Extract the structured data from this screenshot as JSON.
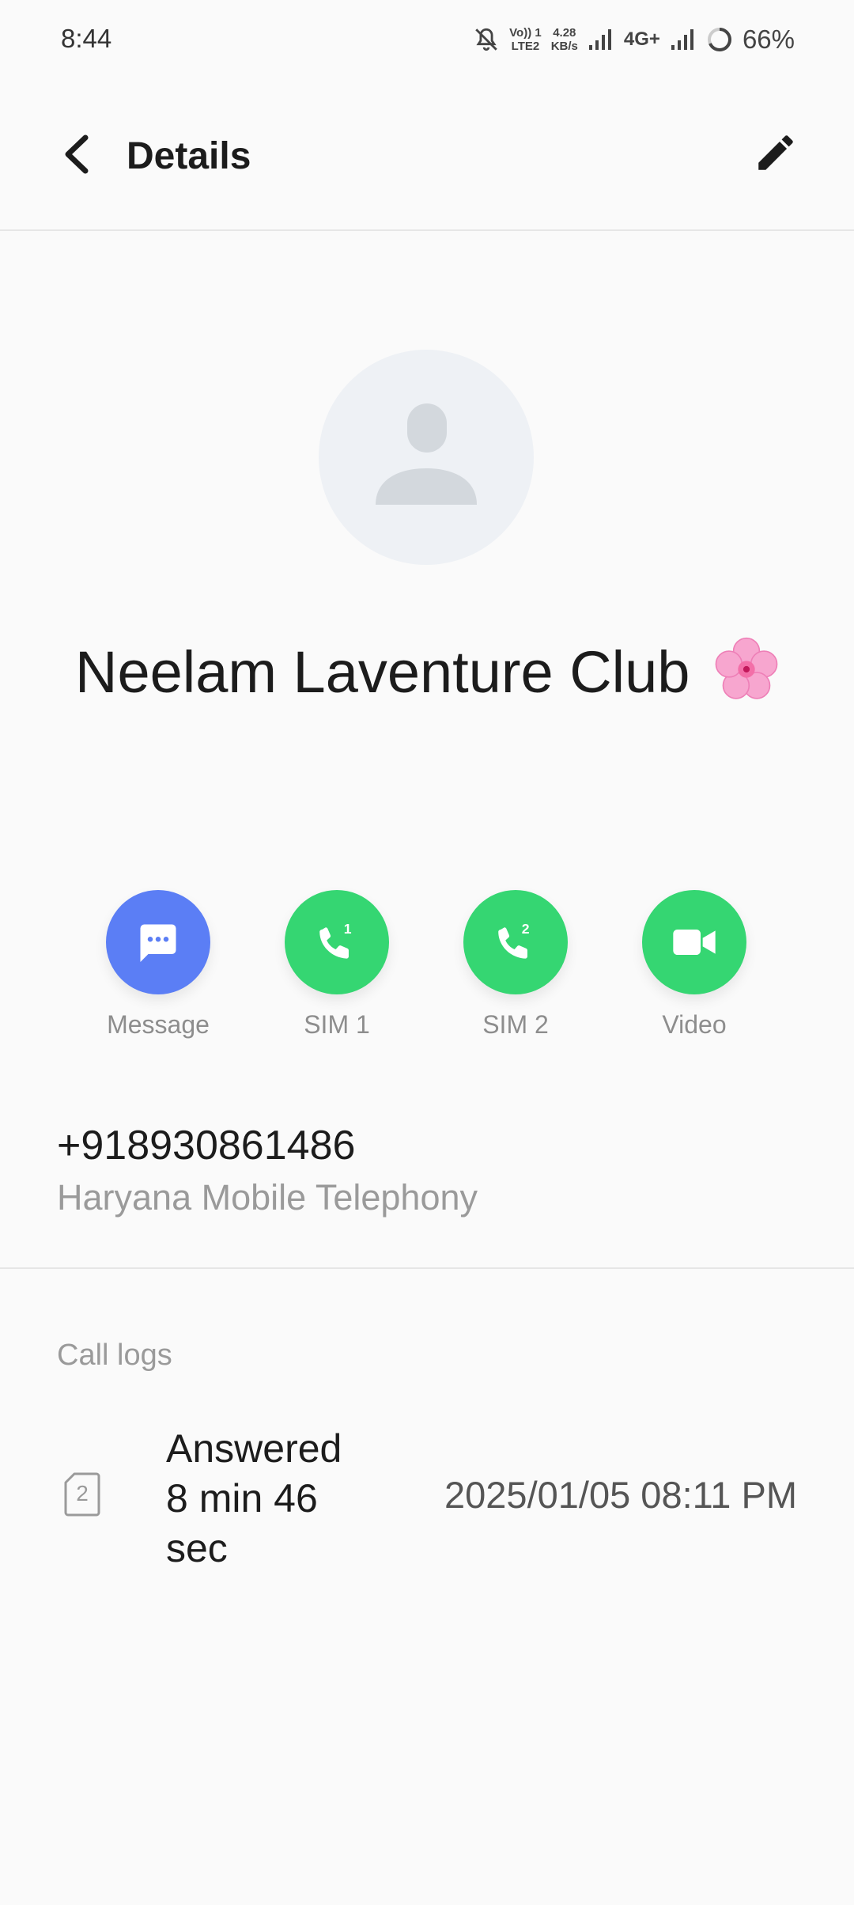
{
  "status_bar": {
    "time": "8:44",
    "net_line1": "Vo)) 1",
    "net_line2": "LTE2",
    "speed_value": "4.28",
    "speed_unit": "KB/s",
    "network_type": "4G+",
    "battery": "66%"
  },
  "app_bar": {
    "title": "Details"
  },
  "contact": {
    "name": "Neelam Laventure Club",
    "avatar_icon": "person-placeholder-icon"
  },
  "actions": [
    {
      "label": "Message",
      "icon": "message-icon",
      "color": "#5b7ef5"
    },
    {
      "label": "SIM 1",
      "icon": "phone-sim1-icon",
      "color": "#35d672"
    },
    {
      "label": "SIM 2",
      "icon": "phone-sim2-icon",
      "color": "#35d672"
    },
    {
      "label": "Video",
      "icon": "video-icon",
      "color": "#35d672"
    }
  ],
  "number": {
    "value": "+918930861486",
    "carrier": "Haryana Mobile Telephony"
  },
  "call_logs": {
    "title": "Call logs",
    "entries": [
      {
        "sim": "2",
        "status": "Answered 8 min 46 sec",
        "datetime": "2025/01/05 08:11 PM"
      }
    ]
  }
}
